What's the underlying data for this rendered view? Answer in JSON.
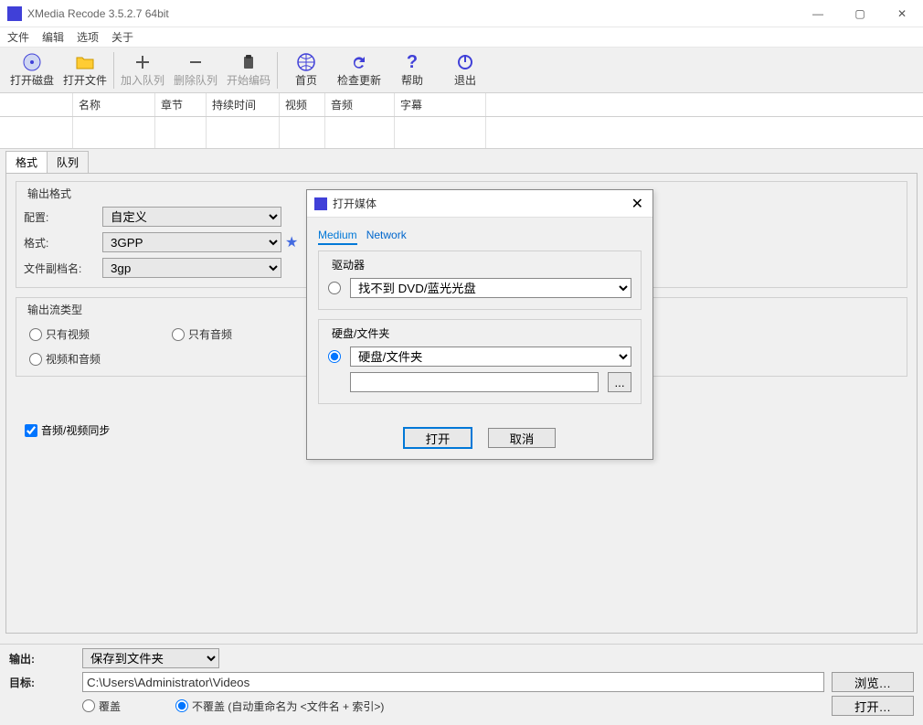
{
  "window": {
    "title": "XMedia Recode 3.5.2.7 64bit"
  },
  "menubar": {
    "file": "文件",
    "edit": "编辑",
    "options": "选项",
    "about": "关于"
  },
  "toolbar": {
    "open_disc": "打开磁盘",
    "open_file": "打开文件",
    "add_queue": "加入队列",
    "remove_queue": "删除队列",
    "start_encode": "开始编码",
    "home": "首页",
    "check_update": "检查更新",
    "help": "帮助",
    "exit": "退出"
  },
  "table_headers": {
    "col0": "",
    "col1": "名称",
    "col2": "章节",
    "col3": "持续时间",
    "col4": "视频",
    "col5": "音频",
    "col6": "字幕"
  },
  "tabs": {
    "format": "格式",
    "queue": "队列"
  },
  "output_format": {
    "group_label": "输出格式",
    "config_label": "配置:",
    "config_value": "自定义",
    "format_label": "格式:",
    "format_value": "3GPP",
    "ext_label": "文件副档名:",
    "ext_value": "3gp"
  },
  "stream_type": {
    "group_label": "输出流类型",
    "video_only": "只有视频",
    "audio_only": "只有音频",
    "both": "视频和音频"
  },
  "av_sync": {
    "label": "音频/视频同步"
  },
  "bottom": {
    "output_label": "输出:",
    "output_value": "保存到文件夹",
    "target_label": "目标:",
    "target_path": "C:\\Users\\Administrator\\Videos",
    "browse": "浏览…",
    "open": "打开…",
    "overwrite": "覆盖",
    "no_overwrite": "不覆盖 (自动重命名为 <文件名 + 索引>)"
  },
  "dialog": {
    "title": "打开媒体",
    "tabs": {
      "medium": "Medium",
      "network": "Network"
    },
    "drive": {
      "label": "驱动器",
      "value": "找不到 DVD/蓝光光盘"
    },
    "folder": {
      "label": "硬盘/文件夹",
      "select_value": "硬盘/文件夹",
      "path": ""
    },
    "buttons": {
      "open": "打开",
      "cancel": "取消"
    },
    "browse_btn": "..."
  }
}
